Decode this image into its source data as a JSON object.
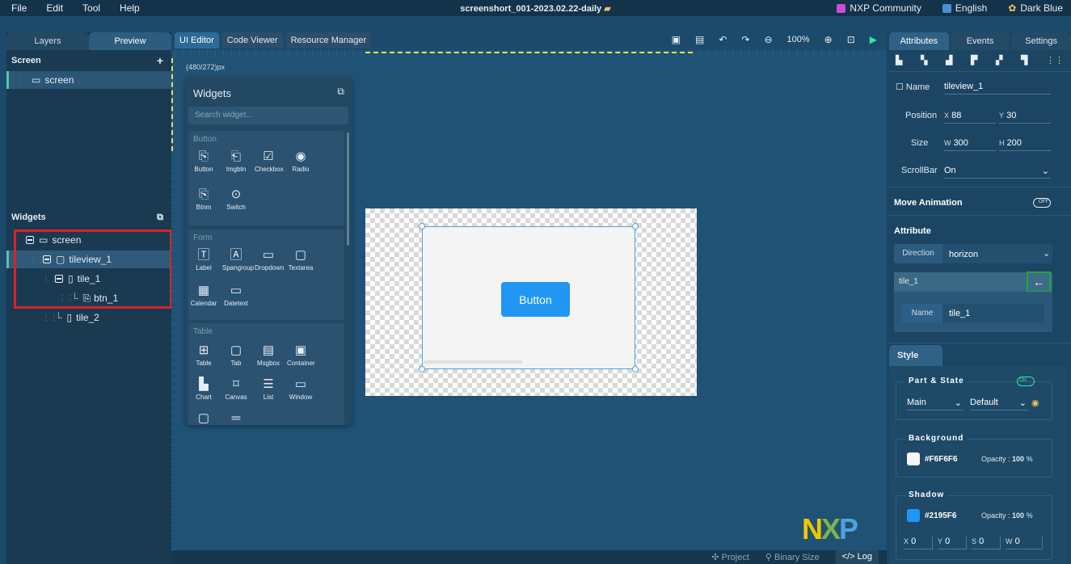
{
  "menu": [
    "File",
    "Edit",
    "Tool",
    "Help"
  ],
  "window_title": "screenshort_001-2023.02.22-daily",
  "top_right": {
    "community": "NXP Community",
    "language": "English",
    "theme": "Dark Blue"
  },
  "left_tabs": [
    "Layers",
    "Preview"
  ],
  "screen_section": {
    "title": "Screen",
    "add": "+",
    "items": [
      "screen"
    ]
  },
  "widgets_section": {
    "title": "Widgets",
    "tree": [
      {
        "label": "screen"
      },
      {
        "label": "tileview_1"
      },
      {
        "label": "tile_1"
      },
      {
        "label": "btn_1"
      },
      {
        "label": "tile_2"
      }
    ]
  },
  "editor_tabs": [
    "UI Editor",
    "Code Viewer",
    "Resource Manager"
  ],
  "toolbar": {
    "zoom": "100%"
  },
  "canvas": {
    "dimension_label": "(480/272)px",
    "button_label": "Button"
  },
  "widget_panel": {
    "title": "Widgets",
    "search_placeholder": "Search widget...",
    "groups": [
      {
        "title": "Button",
        "items": [
          "Button",
          "Imgbtn",
          "Checkbox",
          "Radio",
          "Btnm",
          "Switch"
        ]
      },
      {
        "title": "Form",
        "items": [
          "Label",
          "Spangroup",
          "Dropdown",
          "Textarea",
          "Calendar",
          "Datetext"
        ]
      },
      {
        "title": "Table",
        "items": [
          "Table",
          "Tab",
          "Msgbox",
          "Container",
          "Chart",
          "Canvas",
          "List",
          "Window"
        ]
      }
    ]
  },
  "statusbar": [
    "Project",
    "Binary Size",
    "Log"
  ],
  "logo": "NXP",
  "right_tabs": [
    "Attributes",
    "Events",
    "Settings"
  ],
  "attributes": {
    "name_label": "Name",
    "name_value": "tileview_1",
    "position_label": "Position",
    "x_label": "X",
    "x_value": "88",
    "y_label": "Y",
    "y_value": "30",
    "size_label": "Size",
    "w_label": "W",
    "w_value": "300",
    "h_label": "H",
    "h_value": "200",
    "scrollbar_label": "ScrollBar",
    "scrollbar_value": "On",
    "move_animation": "Move Animation",
    "toggle_off": "OFF",
    "attribute_head": "Attribute",
    "direction_label": "Direction",
    "direction_value": "horizon",
    "tile_row": "tile_1",
    "tile_name_label": "Name",
    "tile_name_value": "tile_1"
  },
  "style": {
    "tab": "Style",
    "part_state": "Part & State",
    "toggle_on": "ON",
    "part": "Main",
    "state": "Default",
    "background_title": "Background",
    "background_color": "#F6F6F6",
    "background_opacity_label": "Opacity :",
    "background_opacity": "100",
    "percent": "%",
    "shadow_title": "Shadow",
    "shadow_color": "#2195F6",
    "shadow_opacity_label": "Opacity :",
    "shadow_opacity": "100",
    "shadow_x_label": "X",
    "shadow_x": "0",
    "shadow_y_label": "Y",
    "shadow_y": "0",
    "shadow_s_label": "S",
    "shadow_s": "0",
    "shadow_w_label": "W",
    "shadow_w": "0"
  },
  "colors": {
    "accent": "#2196f3",
    "highlight_red": "#d9232a",
    "highlight_green": "#1fa83a"
  }
}
